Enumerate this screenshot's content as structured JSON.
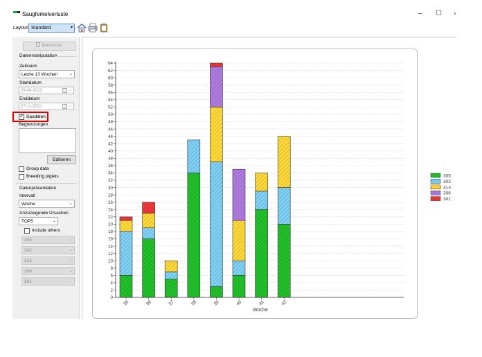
{
  "window": {
    "title": "Saugferkelverluste",
    "minimize": "–",
    "maximize": "☐",
    "more": "›"
  },
  "toolbar": {
    "layout_label": "Layout",
    "layout_value": "Standard"
  },
  "panel": {
    "compute_button": "Berechnen",
    "section_data": "Datenmanipulation",
    "period_label": "Zeitraum",
    "period_value": "Letzte 13 Wochen",
    "start_label": "Startdatum",
    "start_value": "29-08-2022",
    "end_label": "Enddatum",
    "end_value": "27-11-2022",
    "sow_data_label": "Saudaten",
    "limits_label": "Begrenzungen",
    "edit_button": "Editieren",
    "group_data_label": "Group data",
    "breeding_piglets_label": "Breeding piglets",
    "section_presentation": "Datenpräsentation",
    "interval_label": "Intervall",
    "interval_value": "Woche",
    "causes_label": "Anzuzeigende Ursachen",
    "causes_value": "TOP5",
    "include_others_label": "Include others",
    "cause_selects": [
      "305",
      "302",
      "313",
      "306",
      "301"
    ]
  },
  "chart_data": {
    "type": "bar",
    "stacked": true,
    "categories": [
      "35",
      "36",
      "37",
      "38",
      "39",
      "40",
      "41",
      "42"
    ],
    "xlabel": "Woche",
    "ylabel": "",
    "ylim": [
      0,
      64
    ],
    "ytick_step": 2,
    "grid": true,
    "legend_position": "right",
    "series": [
      {
        "name": "305",
        "color": "#22c02a",
        "values": [
          6,
          16,
          5,
          34,
          3,
          6,
          24,
          20
        ]
      },
      {
        "name": "302",
        "color": "#7fd0f5",
        "values": [
          12,
          3,
          2,
          9,
          34,
          4,
          5,
          10
        ]
      },
      {
        "name": "313",
        "color": "#ffd83a",
        "values": [
          3,
          4,
          3,
          0,
          15,
          11,
          5,
          14
        ]
      },
      {
        "name": "306",
        "color": "#b07be0",
        "values": [
          0,
          0,
          0,
          0,
          11,
          14,
          0,
          0
        ]
      },
      {
        "name": "301",
        "color": "#ee3838",
        "values": [
          1,
          3,
          0,
          0,
          1,
          0,
          0,
          0
        ]
      }
    ]
  }
}
